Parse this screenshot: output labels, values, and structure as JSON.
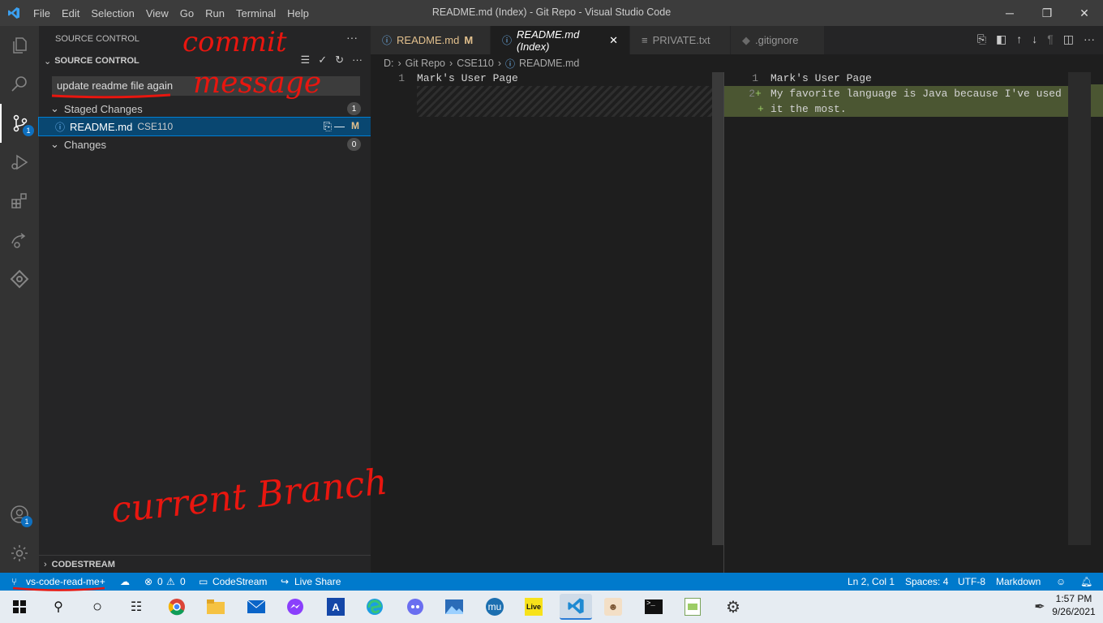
{
  "window": {
    "title": "README.md (Index) - Git Repo - Visual Studio Code",
    "menu": [
      "File",
      "Edit",
      "Selection",
      "View",
      "Go",
      "Run",
      "Terminal",
      "Help"
    ],
    "controls": {
      "minimize": "─",
      "maximize": "❐",
      "close": "✕"
    }
  },
  "activity_bar": {
    "source_control_badge": "1",
    "accounts_badge": "1"
  },
  "sidebar": {
    "header": "SOURCE CONTROL",
    "section_title": "SOURCE CONTROL",
    "commit_message": "update readme file again",
    "staged": {
      "label": "Staged Changes",
      "count": "1"
    },
    "staged_file": {
      "name": "README.md",
      "folder": "CSE110",
      "status": "M"
    },
    "changes": {
      "label": "Changes",
      "count": "0"
    },
    "footer_section": "CODESTREAM"
  },
  "editor": {
    "tabs": [
      {
        "label": "README.md",
        "status": "M",
        "active": false
      },
      {
        "label": "README.md (Index)",
        "status": "",
        "active": true
      },
      {
        "label": "PRIVATE.txt",
        "status": "",
        "active": false
      },
      {
        "label": ".gitignore",
        "status": "",
        "active": false
      }
    ],
    "breadcrumb": [
      "D:",
      "Git Repo",
      "CSE110",
      "README.md"
    ],
    "left_pane": {
      "lines": [
        {
          "num": "1",
          "text": "Mark's User Page"
        }
      ]
    },
    "right_pane": {
      "lines": [
        {
          "num": "1",
          "marker": "",
          "text": "Mark's User Page"
        },
        {
          "num": "2",
          "marker": "+",
          "text": "My favorite language is Java because I've used"
        },
        {
          "num": "",
          "marker": "+",
          "text": "it the most."
        }
      ]
    }
  },
  "status_bar": {
    "branch": "vs-code-read-me+",
    "errors": "0",
    "warnings": "0",
    "codestream": "CodeStream",
    "live_share": "Live Share",
    "cursor": "Ln 2, Col 1",
    "spaces": "Spaces: 4",
    "encoding": "UTF-8",
    "language": "Markdown"
  },
  "taskbar": {
    "time": "1:57 PM",
    "date": "9/26/2021",
    "live_label": "Live"
  },
  "annotations": {
    "commit": "commit",
    "message": "message",
    "current_branch": "current Branch"
  },
  "colors": {
    "accent": "#007acc",
    "annotation": "#e8160f",
    "diff_insert": "#4b5632"
  }
}
